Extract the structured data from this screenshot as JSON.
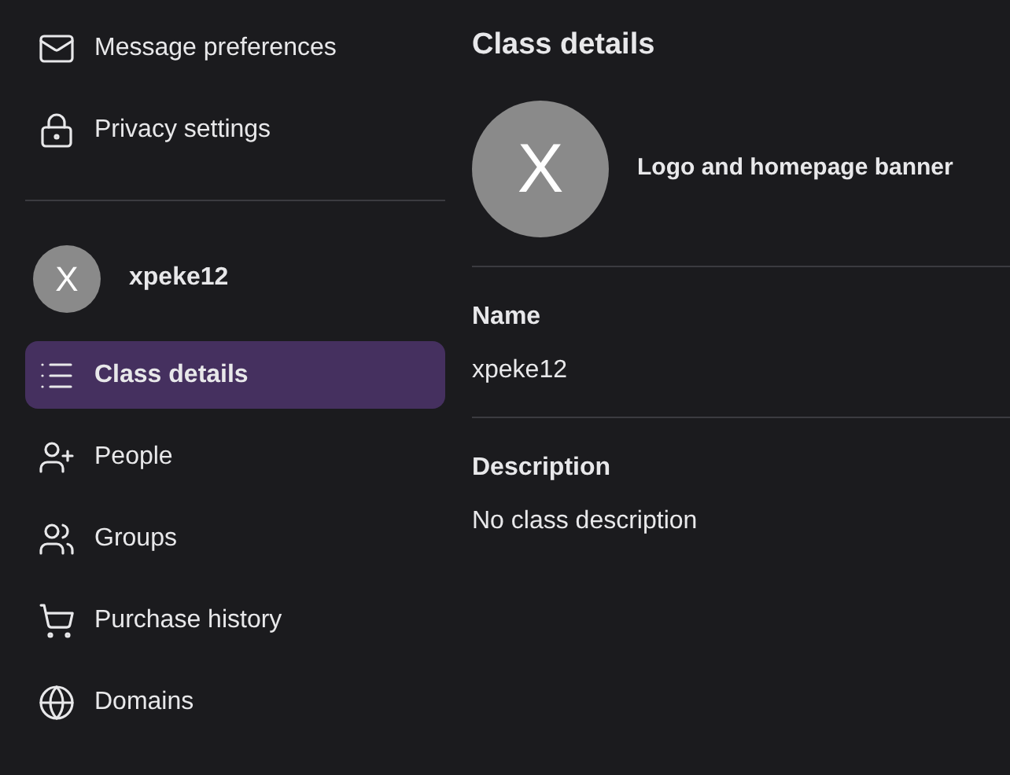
{
  "sidebar": {
    "top_items": [
      {
        "label": "Message preferences"
      },
      {
        "label": "Privacy settings"
      }
    ],
    "class": {
      "avatar_letter": "X",
      "name": "xpeke12"
    },
    "nav_items": [
      {
        "label": "Class details",
        "selected": true
      },
      {
        "label": "People",
        "selected": false
      },
      {
        "label": "Groups",
        "selected": false
      },
      {
        "label": "Purchase history",
        "selected": false
      },
      {
        "label": "Domains",
        "selected": false
      }
    ]
  },
  "main": {
    "title": "Class details",
    "logo": {
      "letter": "X",
      "label": "Logo and homepage banner"
    },
    "fields": [
      {
        "label": "Name",
        "value": "xpeke12"
      },
      {
        "label": "Description",
        "value": "No class description"
      }
    ]
  }
}
